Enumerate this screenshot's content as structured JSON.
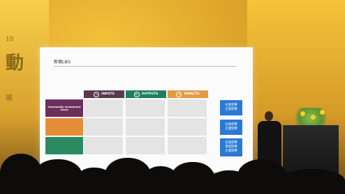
{
  "backdrop": {
    "text_top": "10",
    "text_big": "動",
    "text_small": "展"
  },
  "slide": {
    "title": "新價LBG",
    "intro": "",
    "headers": {
      "inputs": "INPUTS",
      "outputs": "OUTPUTS",
      "impacts": "IMPACTS"
    },
    "rows": [
      {
        "label": "Community Investment Socio",
        "color": "#6b2f5b",
        "cells": [
          "",
          "",
          ""
        ],
        "button": "社會影響\n企業影響"
      },
      {
        "label": "",
        "color": "#e58d37",
        "cells": [
          "",
          "",
          ""
        ],
        "button": "社會影響\n企業影響"
      },
      {
        "label": "",
        "color": "#2c8a63",
        "cells": [
          "",
          "",
          ""
        ],
        "button": "社會影響\n環境影響\n企業影響"
      }
    ]
  }
}
